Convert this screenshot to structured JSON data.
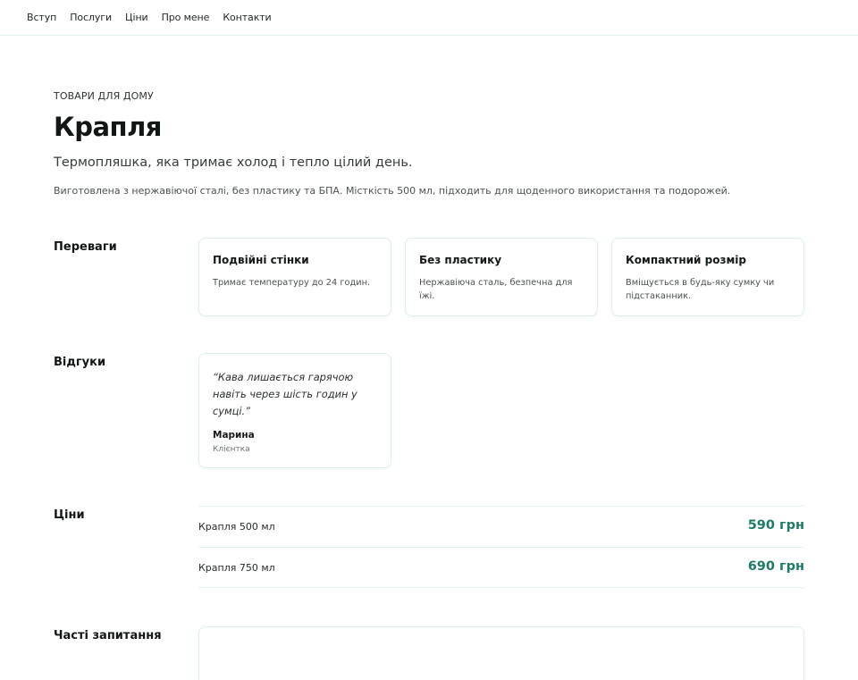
{
  "nav": {
    "items": [
      "Вступ",
      "Послуги",
      "Ціни",
      "Про мене",
      "Контакти"
    ]
  },
  "hero": {
    "eyebrow": "ТОВАРИ ДЛЯ ДОМУ",
    "title": "Крапля",
    "tagline": "Термопляшка, яка тримає холод і тепло цілий день.",
    "description": "Виготовлена з нержавіючої сталі, без пластику та БПА. Місткість 500 мл, підходить для щоденного використання та подорожей."
  },
  "features": {
    "label": "Переваги",
    "items": [
      {
        "title": "Подвійні стінки",
        "text": "Тримає температуру до 24 годин."
      },
      {
        "title": "Без пластику",
        "text": "Нержавіюча сталь, безпечна для їжі."
      },
      {
        "title": "Компактний розмір",
        "text": "Вміщується в будь-яку сумку чи підстаканник."
      }
    ]
  },
  "reviews": {
    "label": "Відгуки",
    "items": [
      {
        "quote": "“Кава лишається гарячою навіть через шість годин у сумці.”",
        "author": "Марина",
        "role": "Клієнтка"
      }
    ]
  },
  "prices": {
    "label": "Ціни",
    "items": [
      {
        "name": "Крапля 500 мл",
        "price": "590 грн"
      },
      {
        "name": "Крапля 750 мл",
        "price": "690 грн"
      }
    ]
  },
  "faq": {
    "label": "Часті запитання"
  },
  "colors": {
    "accent": "#1f7a66",
    "border": "#dcefeb",
    "text": "#121615"
  }
}
